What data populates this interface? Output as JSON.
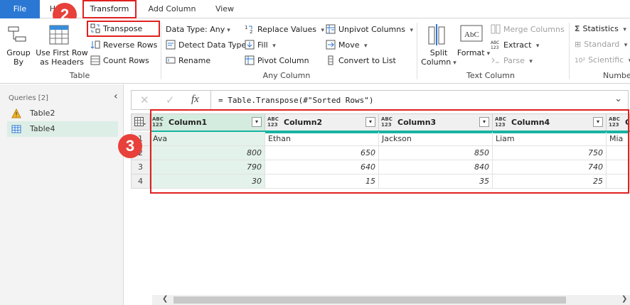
{
  "tabs": [
    {
      "label": "File"
    },
    {
      "label": "Home"
    },
    {
      "label": "Transform"
    },
    {
      "label": "Add Column"
    },
    {
      "label": "View"
    }
  ],
  "badges": {
    "step2": "2",
    "step3": "3"
  },
  "ribbon": {
    "table_group": {
      "group_by": "Group\nBy",
      "use_first_row": "Use First Row\nas Headers",
      "transpose": "Transpose",
      "reverse_rows": "Reverse Rows",
      "count_rows": "Count Rows",
      "label": "Table"
    },
    "any_column_group": {
      "data_type": "Data Type: Any",
      "detect_data_type": "Detect Data Type",
      "rename": "Rename",
      "replace_values": "Replace Values",
      "fill": "Fill",
      "pivot_column": "Pivot Column",
      "unpivot_columns": "Unpivot Columns",
      "move": "Move",
      "convert_to_list": "Convert to List",
      "label": "Any Column"
    },
    "text_column_group": {
      "split_column": "Split\nColumn",
      "format": "Format",
      "merge_columns": "Merge Columns",
      "extract": "Extract",
      "parse": "Parse",
      "label": "Text Column"
    },
    "number_group": {
      "statistics": "Statistics",
      "standard": "Standard",
      "scientific": "Scientific",
      "label": "Numbe"
    }
  },
  "sidebar": {
    "header": "Queries [2]",
    "queries": [
      {
        "name": "Table2",
        "icon": "warning-icon"
      },
      {
        "name": "Table4",
        "icon": "table-icon"
      }
    ]
  },
  "formula_bar": {
    "formula": "= Table.Transpose(#\"Sorted Rows\")",
    "fx": "fx"
  },
  "grid": {
    "type_label_top": "ABC",
    "type_label_bottom": "123",
    "columns": [
      "Column1",
      "Column2",
      "Column3",
      "Column4",
      "C"
    ],
    "rows": [
      {
        "num": "1",
        "cells": [
          "Ava",
          "Ethan",
          "Jackson",
          "Liam",
          "Mia"
        ]
      },
      {
        "num": "2",
        "cells": [
          "800",
          "650",
          "850",
          "750",
          ""
        ]
      },
      {
        "num": "3",
        "cells": [
          "790",
          "640",
          "840",
          "740",
          ""
        ]
      },
      {
        "num": "4",
        "cells": [
          "30",
          "15",
          "35",
          "25",
          ""
        ]
      }
    ]
  },
  "colors": {
    "accent": "#2b78d4",
    "highlight": "#e02020",
    "quality_bar": "#17b3a2",
    "badge": "#e8403a"
  }
}
